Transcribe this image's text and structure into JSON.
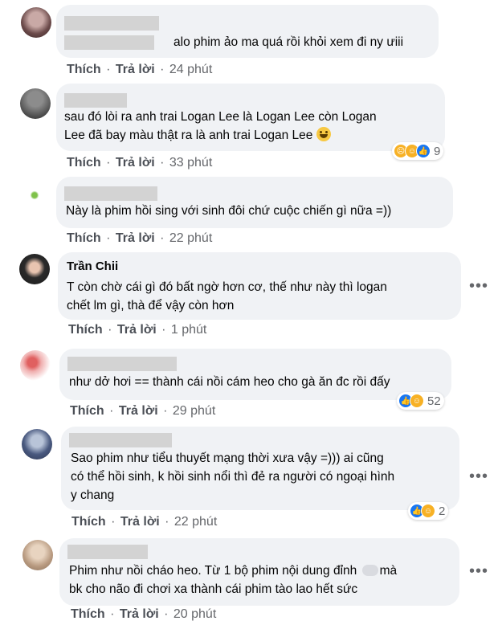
{
  "comments": [
    {
      "name": "",
      "text_lines": [
        "alo phim ảo ma quá rồi khỏi xem đi ny ưiii"
      ],
      "like": "Thích",
      "reply": "Trả lời",
      "time": "24 phút"
    },
    {
      "name": "",
      "text_lines": [
        "sau đó lòi ra anh trai Logan Lee là Logan Lee còn Logan",
        "Lee đã bay màu thật ra là anh trai Logan Lee"
      ],
      "like": "Thích",
      "reply": "Trả lời",
      "time": "33 phút",
      "reactions": [
        "sad",
        "haha",
        "like"
      ],
      "reaction_count": "9"
    },
    {
      "name": "",
      "text_lines": [
        "Này là phim hồi sing với sinh đôi chứ cuộc chiến gì nữa =))"
      ],
      "like": "Thích",
      "reply": "Trả lời",
      "time": "22 phút"
    },
    {
      "name": "Trần Chii",
      "text_lines": [
        "T còn chờ cái gì đó bất ngờ hơn cơ, thế như này thì logan",
        "chết lm gì, thà để vậy còn hơn"
      ],
      "like": "Thích",
      "reply": "Trả lời",
      "time": "1 phút",
      "more": "•••"
    },
    {
      "name": "",
      "text_lines": [
        "như dở hơi == thành cái nồi cám heo cho gà ăn đc rồi đấy"
      ],
      "like": "Thích",
      "reply": "Trả lời",
      "time": "29 phút",
      "reactions": [
        "like",
        "haha"
      ],
      "reaction_count": "52"
    },
    {
      "name": "",
      "text_lines": [
        "Sao phim như tiểu thuyết mạng thời xưa vậy =))) ai cũng",
        "có thể hồi sinh, k hồi sinh nổi thì đẻ ra người có ngoại hình",
        "y chang"
      ],
      "like": "Thích",
      "reply": "Trả lời",
      "time": "22 phút",
      "more": "•••",
      "reactions": [
        "like",
        "haha"
      ],
      "reaction_count": "2"
    },
    {
      "name": "",
      "text_lines": [
        "Phim như nồi cháo heo. Từ 1 bộ phim nội dung đỉnh",
        "bk cho não đi chơi xa thành cái phim tào lao hết sức"
      ],
      "line0_suffix": "mà",
      "like": "Thích",
      "reply": "Trả lời",
      "time": "20 phút",
      "more": "•••"
    }
  ],
  "colors": {
    "bubble": "#f0f2f5",
    "like_blue": "#1877f2",
    "haha_yellow": "#f7b125",
    "meta_gray": "#65676b"
  }
}
